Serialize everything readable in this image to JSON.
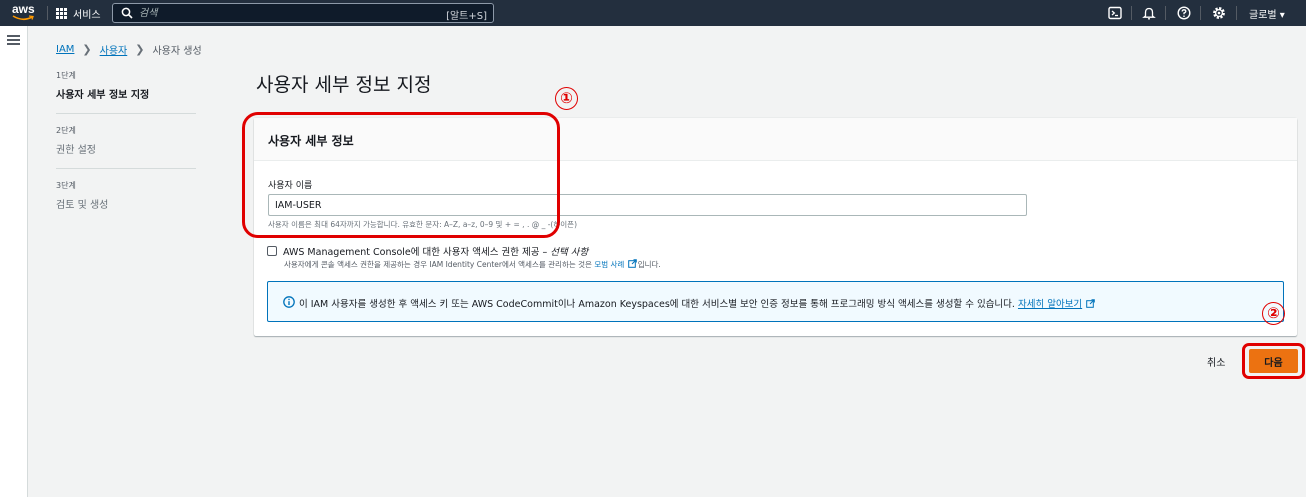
{
  "nav": {
    "logo_text": "aws",
    "services_label": "서비스",
    "search_placeholder": "검색",
    "search_shortcut": "[알트+S]",
    "region_label": "글로벌 ▾",
    "icons": [
      "grid-icon",
      "search-icon",
      "cloudshell-icon",
      "bell-icon",
      "help-icon",
      "gear-icon"
    ]
  },
  "breadcrumb": {
    "root": "IAM",
    "parent": "사용자",
    "current": "사용자 생성"
  },
  "steps": [
    {
      "num": "1단계",
      "name": "사용자 세부 정보 지정",
      "active": true
    },
    {
      "num": "2단계",
      "name": "권한 설정",
      "active": false
    },
    {
      "num": "3단계",
      "name": "검토 및 생성",
      "active": false
    }
  ],
  "page_title": "사용자 세부 정보 지정",
  "panel": {
    "title": "사용자 세부 정보",
    "username_label": "사용자 이름",
    "username_value": "IAM-USER",
    "username_hint": "사용자 이름은 최대 64자까지 가능합니다. 유효한 문자: A–Z, a–z, 0–9 및 + = , . @ _ -(하이픈)",
    "console_access_label": "AWS Management Console에 대한 사용자 액세스 권한 제공 –",
    "console_access_optional": "선택 사항",
    "console_access_desc_before": "사용자에게 콘솔 액세스 권한을 제공하는 경우 IAM Identity Center에서 액세스를 관리하는 것은",
    "console_access_desc_link": "모범 사례",
    "console_access_desc_after": "입니다.",
    "console_access_checked": false,
    "info_text": "이 IAM 사용자를 생성한 후 액세스 키 또는 AWS CodeCommit이나 Amazon Keyspaces에 대한 서비스별 보안 인증 정보를 통해 프로그래밍 방식 액세스를 생성할 수 있습니다.",
    "info_link": "자세히 알아보기"
  },
  "actions": {
    "cancel_label": "취소",
    "next_label": "다음"
  },
  "annotations": {
    "marker_1": "①",
    "marker_2": "②",
    "color": "#e00000"
  },
  "colors": {
    "nav_bg": "#232f3e",
    "primary_button": "#ec7211",
    "link": "#0073bb",
    "info_bg": "#f1faff"
  }
}
